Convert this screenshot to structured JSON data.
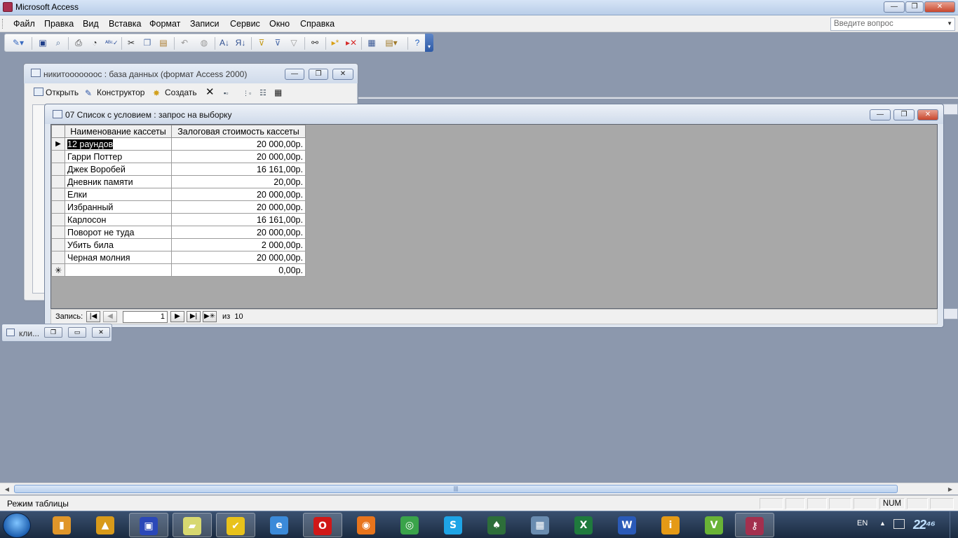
{
  "app": {
    "title": "Microsoft Access",
    "controls": {
      "minimize": "—",
      "restore": "❐",
      "close": "✕"
    }
  },
  "menu": {
    "items": [
      {
        "label": "Файл",
        "key": "Ф"
      },
      {
        "label": "Правка",
        "key": "П"
      },
      {
        "label": "Вид",
        "key": "В"
      },
      {
        "label": "Вставка",
        "key": "с"
      },
      {
        "label": "Формат",
        "key": "о"
      },
      {
        "label": "Записи",
        "key": "З"
      },
      {
        "label": "Сервис",
        "key": "С"
      },
      {
        "label": "Окно",
        "key": "О"
      },
      {
        "label": "Справка",
        "key": "С"
      }
    ],
    "help_placeholder": "Введите вопрос"
  },
  "toolbar": {
    "icons": [
      "view-icon",
      "save-icon",
      "file-search-icon",
      "print-icon",
      "print-preview-icon",
      "spelling-icon",
      "cut-icon",
      "copy-icon",
      "paste-icon",
      "undo-icon",
      "hyperlink-icon",
      "sort-ascending-icon",
      "sort-descending-icon",
      "filter-by-selection-icon",
      "filter-by-form-icon",
      "apply-filter-icon",
      "find-icon",
      "new-record-icon",
      "delete-record-icon",
      "database-window-icon",
      "new-object-icon",
      "help-icon"
    ]
  },
  "db_window": {
    "title": "никитооооооос : база данных (формат Access 2000)",
    "open_label": "Открыть",
    "design_label": "Конструктор",
    "create_label": "Создать"
  },
  "query_window": {
    "title": "07 Список с условием : запрос на выборку",
    "columns": [
      "Наименование кассеты",
      "Залоговая стоимость кассеты"
    ],
    "rows": [
      {
        "name": "12 раундов",
        "price": "20 000,00р."
      },
      {
        "name": "Гарри Поттер",
        "price": "20 000,00р."
      },
      {
        "name": "Джек Воробей",
        "price": "16 161,00р."
      },
      {
        "name": "Дневник памяти",
        "price": "20,00р."
      },
      {
        "name": "Елки",
        "price": "20 000,00р."
      },
      {
        "name": "Избранный",
        "price": "20 000,00р."
      },
      {
        "name": "Карлосон",
        "price": "16 161,00р."
      },
      {
        "name": "Поворот не туда",
        "price": "20 000,00р."
      },
      {
        "name": "Убить била",
        "price": "2 000,00р."
      },
      {
        "name": "Черная молния",
        "price": "20 000,00р."
      }
    ],
    "new_row_price": "0,00р.",
    "nav": {
      "label": "Запись:",
      "current": "1",
      "of_label": "из",
      "total": "10"
    }
  },
  "minimized_window": {
    "title": "кли..."
  },
  "statusbar": {
    "text": "Режим таблицы",
    "num": "NUM"
  },
  "taskbar": {
    "apps": [
      {
        "name": "winrar",
        "glyph": "▮",
        "color": "#e0962a"
      },
      {
        "name": "archicad",
        "glyph": "▲",
        "color": "#d89a1a"
      },
      {
        "name": "floppy",
        "glyph": "▣",
        "color": "#2b48b8"
      },
      {
        "name": "sticky-notes",
        "glyph": "▰",
        "color": "#d7d870"
      },
      {
        "name": "norton-check",
        "glyph": "✔",
        "color": "#e8c21b"
      },
      {
        "name": "internet-explorer",
        "glyph": "e",
        "color": "#3b8ad9"
      },
      {
        "name": "opera",
        "glyph": "O",
        "color": "#d01818"
      },
      {
        "name": "firefox",
        "glyph": "◉",
        "color": "#e8741c"
      },
      {
        "name": "chrome",
        "glyph": "◎",
        "color": "#3aa34a"
      },
      {
        "name": "skype",
        "glyph": "S",
        "color": "#1ea4e6"
      },
      {
        "name": "solitaire",
        "glyph": "♠",
        "color": "#2d6e3a"
      },
      {
        "name": "calendar",
        "glyph": "▦",
        "color": "#6a8cb0"
      },
      {
        "name": "excel",
        "glyph": "X",
        "color": "#1f7a3d"
      },
      {
        "name": "word",
        "glyph": "W",
        "color": "#2a5ab8"
      },
      {
        "name": "info",
        "glyph": "i",
        "color": "#e59a16"
      },
      {
        "name": "vector-app",
        "glyph": "V",
        "color": "#69b336"
      },
      {
        "name": "access",
        "glyph": "⚷",
        "color": "#a3304e"
      }
    ],
    "lang": "EN",
    "clock": "22⁴⁶"
  }
}
